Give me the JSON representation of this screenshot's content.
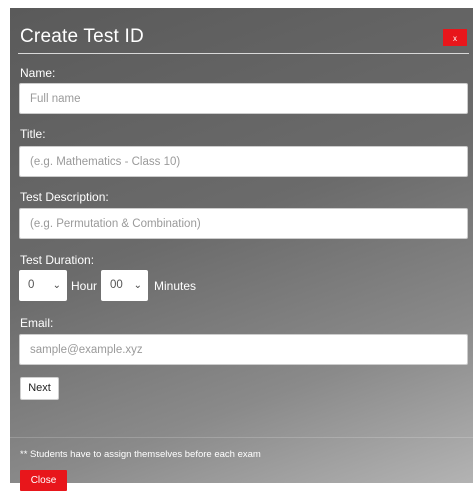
{
  "dialog": {
    "title": "Create Test ID",
    "close_x_label": "x"
  },
  "form": {
    "name_label": "Name:",
    "name_placeholder": "Full name",
    "title_label": "Title:",
    "title_placeholder": "(e.g. Mathematics - Class 10)",
    "description_label": "Test Description:",
    "description_placeholder": "(e.g. Permutation & Combination)",
    "duration_label": "Test Duration:",
    "hour_value": "0",
    "hour_text": "Hour",
    "minutes_value": "00",
    "minutes_text": "Minutes",
    "email_label": "Email:",
    "email_placeholder": "sample@example.xyz",
    "next_label": "Next"
  },
  "footer": {
    "note": "** Students have to assign themselves before each exam",
    "close_label": "Close"
  },
  "colors": {
    "accent_red": "#e8161b",
    "panel_dark": "#5a5a5a",
    "panel_light": "#b3b3b3"
  }
}
